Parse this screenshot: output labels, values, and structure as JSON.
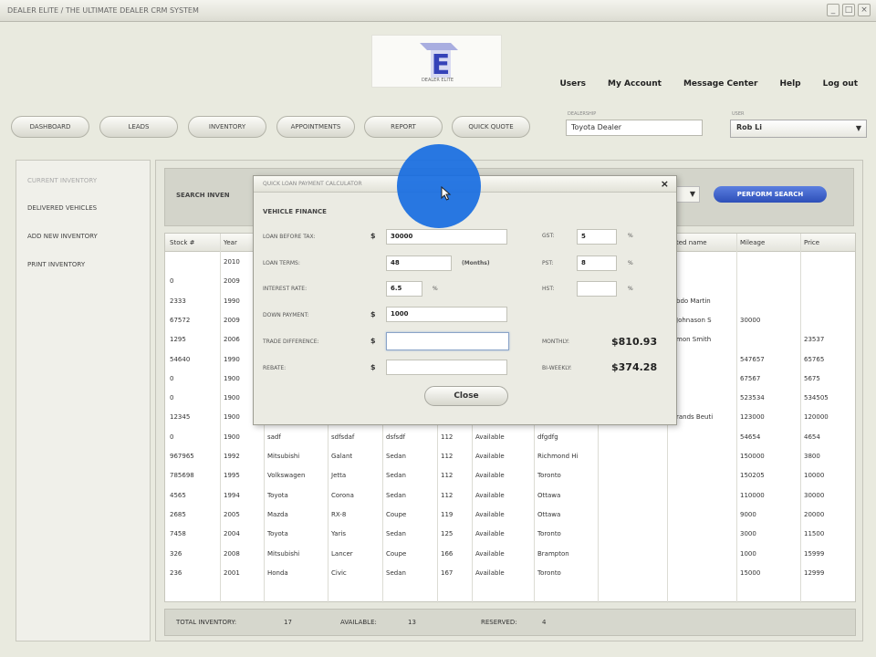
{
  "window": {
    "title": "DEALER ELITE / THE ULTIMATE DEALER CRM SYSTEM",
    "buttons": [
      "_",
      "□",
      "×"
    ]
  },
  "logo": {
    "letter": "E",
    "caption": "DEALER ELITE"
  },
  "toplinks": [
    "Users",
    "My Account",
    "Message Center",
    "Help",
    "Log out"
  ],
  "nav": [
    "DASHBOARD",
    "LEADS",
    "INVENTORY",
    "APPOINTMENTS",
    "REPORT",
    "QUICK QUOTE"
  ],
  "dealership": {
    "label": "DEALERSHIP",
    "value": "Toyota Dealer"
  },
  "user": {
    "label": "USER",
    "value": "Rob Li"
  },
  "sidebar": [
    "CURRENT INVENTORY",
    "DELIVERED VEHICLES",
    "ADD NEW INVENTORY",
    "PRINT INVENTORY"
  ],
  "search": {
    "label": "SEARCH INVEN",
    "button": "PERFORM SEARCH"
  },
  "grid": {
    "headers": [
      "Stock #",
      "Year",
      "",
      "",
      "",
      "",
      "",
      "",
      "",
      "ted name",
      "Mileage",
      "Price"
    ],
    "rows": [
      [
        "",
        "2010",
        "",
        "",
        "",
        "",
        "",
        "",
        "",
        "",
        "",
        ""
      ],
      [
        "0",
        "2009",
        "",
        "",
        "",
        "",
        "",
        "",
        "",
        "",
        "",
        ""
      ],
      [
        "2333",
        "1990",
        "",
        "",
        "",
        "",
        "",
        "",
        "",
        "bdo Martin",
        "",
        ""
      ],
      [
        "67572",
        "2009",
        "",
        "",
        "",
        "",
        "",
        "",
        "",
        "Johnason S",
        "30000",
        ""
      ],
      [
        "1295",
        "2006",
        "",
        "",
        "",
        "",
        "",
        "",
        "",
        "mon Smith",
        "",
        "23537"
      ],
      [
        "54640",
        "1990",
        "",
        "",
        "",
        "",
        "",
        "",
        "",
        "",
        "547657",
        "65765"
      ],
      [
        "0",
        "1900",
        "",
        "",
        "",
        "",
        "",
        "",
        "",
        "",
        "67567",
        "5675"
      ],
      [
        "0",
        "1900",
        "",
        "",
        "",
        "",
        "",
        "",
        "",
        "",
        "523534",
        "534505"
      ],
      [
        "12345",
        "1900",
        "",
        "",
        "",
        "",
        "",
        "",
        "",
        "rands Beuti",
        "123000",
        "120000"
      ],
      [
        "0",
        "1900",
        "sadf",
        "sdfsdaf",
        "dsfsdf",
        "112",
        "Available",
        "dfgdfg",
        "",
        "",
        "54654",
        "4654"
      ],
      [
        "967965",
        "1992",
        "Mitsubishi",
        "Galant",
        "Sedan",
        "112",
        "Available",
        "Richmond Hi",
        "",
        "",
        "150000",
        "3800"
      ],
      [
        "785698",
        "1995",
        "Volkswagen",
        "Jetta",
        "Sedan",
        "112",
        "Available",
        "Toronto",
        "",
        "",
        "150205",
        "10000"
      ],
      [
        "4565",
        "1994",
        "Toyota",
        "Corona",
        "Sedan",
        "112",
        "Available",
        "Ottawa",
        "",
        "",
        "110000",
        "30000"
      ],
      [
        "2685",
        "2005",
        "Mazda",
        "RX-8",
        "Coupe",
        "119",
        "Available",
        "Ottawa",
        "",
        "",
        "9000",
        "20000"
      ],
      [
        "7458",
        "2004",
        "Toyota",
        "Yaris",
        "Sedan",
        "125",
        "Available",
        "Toronto",
        "",
        "",
        "3000",
        "11500"
      ],
      [
        "326",
        "2008",
        "Mitsubishi",
        "Lancer",
        "Coupe",
        "166",
        "Available",
        "Brampton",
        "",
        "",
        "1000",
        "15999"
      ],
      [
        "236",
        "2001",
        "Honda",
        "Civic",
        "Sedan",
        "167",
        "Available",
        "Toronto",
        "",
        "",
        "15000",
        "12999"
      ]
    ]
  },
  "footer": {
    "total_label": "TOTAL INVENTORY:",
    "total": "17",
    "available_label": "AVAILABLE:",
    "available": "13",
    "reserved_label": "RESERVED:",
    "reserved": "4"
  },
  "modal": {
    "title": "QUICK LOAN PAYMENT CALCULATOR",
    "close_x": "×",
    "section": "VEHICLE FINANCE",
    "fields": [
      {
        "label": "LOAN BEFORE TAX:",
        "currency": "$",
        "value": "30000"
      },
      {
        "label": "LOAN TERMS:",
        "value": "48",
        "suffix": "(Months)"
      },
      {
        "label": "INTEREST RATE:",
        "value": "6.5",
        "suffix": "%"
      },
      {
        "label": "DOWN PAYMENT:",
        "currency": "$",
        "value": "1000"
      },
      {
        "label": "TRADE DIFFERENCE:",
        "currency": "$",
        "value": ""
      },
      {
        "label": "REBATE:",
        "currency": "$",
        "value": ""
      }
    ],
    "taxes": [
      {
        "label": "GST:",
        "value": "5",
        "suffix": "%"
      },
      {
        "label": "PST:",
        "value": "8",
        "suffix": "%"
      },
      {
        "label": "HST:",
        "value": "",
        "suffix": "%"
      }
    ],
    "results": [
      {
        "label": "MONTHLY:",
        "value": "$810.93"
      },
      {
        "label": "BI-WEEKLY:",
        "value": "$374.28"
      }
    ],
    "close_button": "Close"
  }
}
